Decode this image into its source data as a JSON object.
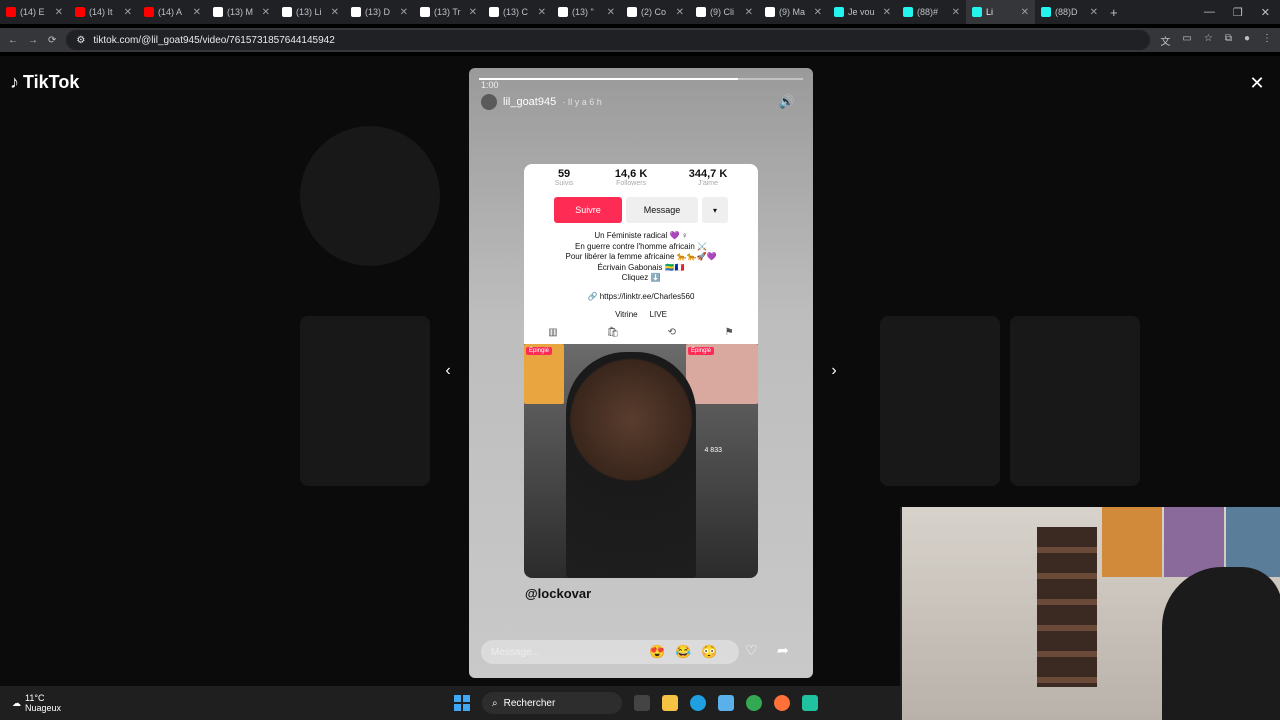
{
  "browser": {
    "tabs": [
      {
        "title": "(14) E",
        "color": "#ff0000"
      },
      {
        "title": "(14) It",
        "color": "#ff0000"
      },
      {
        "title": "(14) A",
        "color": "#ff0000"
      },
      {
        "title": "(13) M",
        "color": "#ffffff"
      },
      {
        "title": "(13) Li",
        "color": "#ffffff"
      },
      {
        "title": "(13) D",
        "color": "#ffffff"
      },
      {
        "title": "(13) Tr",
        "color": "#ffffff"
      },
      {
        "title": "(13) C",
        "color": "#ffffff"
      },
      {
        "title": "(13) \"",
        "color": "#ffffff"
      },
      {
        "title": "(2) Co",
        "color": "#ffffff"
      },
      {
        "title": "(9) Cli",
        "color": "#ffffff"
      },
      {
        "title": "(9) Ma",
        "color": "#ffffff"
      },
      {
        "title": "Je vou",
        "color": "#25f4ee"
      },
      {
        "title": "(88)#",
        "color": "#25f4ee"
      },
      {
        "title": "Li",
        "color": "#25f4ee"
      },
      {
        "title": "(88)D",
        "color": "#25f4ee"
      }
    ],
    "url": "tiktok.com/@lil_goat945/video/7615731857644145942"
  },
  "tiktok": {
    "brand": "TikTok",
    "story": {
      "time": "1:00",
      "progress": 0.8,
      "username": "lil_goat945",
      "posted": "· Il y a 6 h",
      "profile": {
        "stats": [
          {
            "value": "59",
            "label": "Suivis"
          },
          {
            "value": "14,6 K",
            "label": "Followers"
          },
          {
            "value": "344,7 K",
            "label": "J'aime"
          }
        ],
        "follow": "Suivre",
        "message": "Message",
        "more": "▾",
        "bio": [
          "Un Féministe radical 💜 ♀",
          "En guerre contre l'homme africain ⚔️",
          "Pour libérer la femme africaine 🐆🐆🚀💜",
          "Écrivain Gabonais 🇬🇦🇫🇷",
          "Cliquez ⬇️"
        ],
        "link": "🔗 https://linktr.ee/Charles560",
        "shop": "Vitrine",
        "live": "LIVE",
        "pinned_left": "Épinglé",
        "pinned_right": "Épinglé",
        "video_count": "4 833"
      },
      "mention": "@lockovar",
      "reply_placeholder": "Message...",
      "emojis": [
        "😍",
        "😂",
        "😳"
      ]
    }
  },
  "taskbar": {
    "temp": "11°C",
    "weather": "Nuageux",
    "search": "Rechercher"
  }
}
